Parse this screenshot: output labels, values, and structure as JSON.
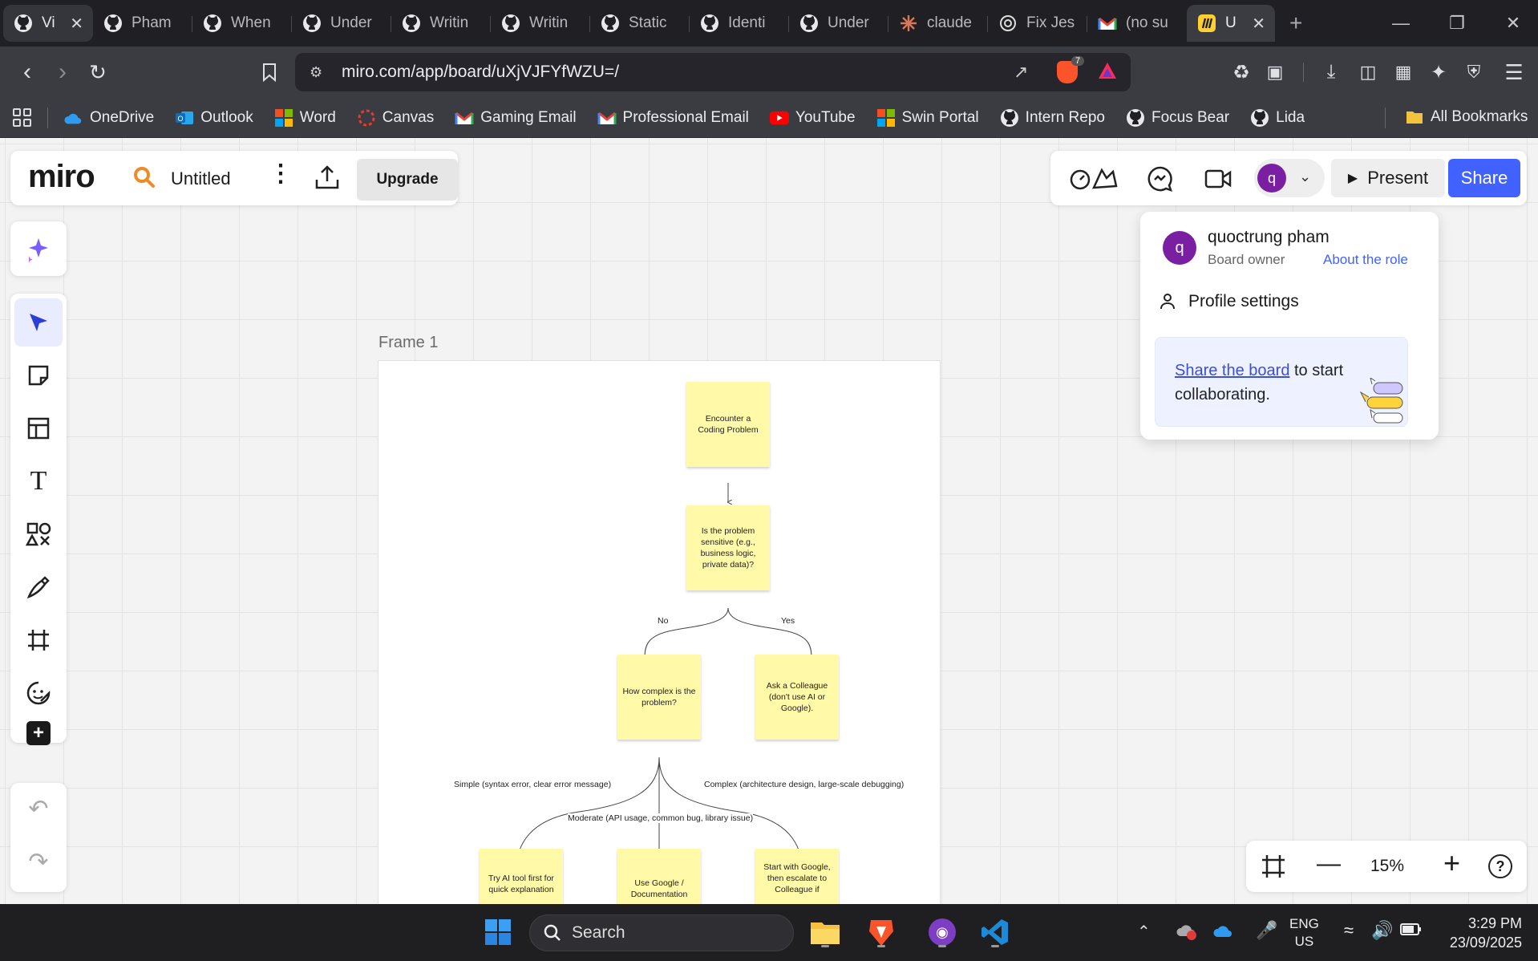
{
  "browser": {
    "tabs": [
      {
        "label": "Vi",
        "icon": "github-icon"
      },
      {
        "label": "Pham",
        "icon": "github-icon"
      },
      {
        "label": "When",
        "icon": "github-icon"
      },
      {
        "label": "Under",
        "icon": "github-icon"
      },
      {
        "label": "Writin",
        "icon": "github-icon"
      },
      {
        "label": "Writin",
        "icon": "github-icon"
      },
      {
        "label": "Static",
        "icon": "github-icon"
      },
      {
        "label": "Identi",
        "icon": "github-icon"
      },
      {
        "label": "Under",
        "icon": "github-icon"
      },
      {
        "label": "claude",
        "icon": "claude-icon"
      },
      {
        "label": "Fix Jes",
        "icon": "openai-icon"
      },
      {
        "label": "(no su",
        "icon": "gmail-icon"
      },
      {
        "label": "U",
        "icon": "miro-icon"
      }
    ],
    "url": "miro.com/app/board/uXjVJFYfWZU=/",
    "brave_badge": "7",
    "bookmarks": [
      {
        "label": "OneDrive",
        "icon": "onedrive-icon"
      },
      {
        "label": "Outlook",
        "icon": "outlook-icon"
      },
      {
        "label": "Word",
        "icon": "microsoft-icon"
      },
      {
        "label": "Canvas",
        "icon": "canvas-icon"
      },
      {
        "label": "Gaming Email",
        "icon": "gmail-icon"
      },
      {
        "label": "Professional Email",
        "icon": "gmail-icon"
      },
      {
        "label": "YouTube",
        "icon": "youtube-icon"
      },
      {
        "label": "Swin Portal",
        "icon": "microsoft-icon"
      },
      {
        "label": "Intern Repo",
        "icon": "github-icon"
      },
      {
        "label": "Focus Bear",
        "icon": "github-icon"
      },
      {
        "label": "Lida",
        "icon": "github-icon"
      }
    ],
    "all_bookmarks": "All Bookmarks"
  },
  "miro": {
    "logo": "miro",
    "board_title": "Untitled",
    "upgrade": "Upgrade",
    "present": "Present",
    "share": "Share",
    "avatar_letter": "q",
    "zoom": "15%",
    "frame_label": "Frame 1",
    "accent": "#4262ff",
    "sticky_color": "#fff9a8"
  },
  "profile_popover": {
    "name": "quoctrung pham",
    "role": "Board owner",
    "about_role": "About the role",
    "profile_settings": "Profile settings",
    "share_link": "Share the board",
    "share_rest": " to start collaborating."
  },
  "flowchart": {
    "nodes": {
      "start": "Encounter a Coding Problem",
      "sensitive": "Is the problem sensitive (e.g., business logic, private data)?",
      "complexity": "How complex is the problem?",
      "colleague": "Ask a Colleague (don't use AI or Google).",
      "ai_tool": "Try AI tool first for quick explanation",
      "google": "Use Google / Documentation",
      "escalate": "Start with Google, then escalate to Colleague if"
    },
    "edge_labels": {
      "no": "No",
      "yes": "Yes",
      "simple": "Simple (syntax error, clear error message)",
      "moderate": "Moderate (API usage, common bug, library issue)",
      "complex": "Complex (architecture design, large-scale debugging)"
    }
  },
  "taskbar": {
    "search": "Search",
    "lang_top": "ENG",
    "lang_bottom": "US",
    "time": "3:29 PM",
    "date": "23/09/2025"
  }
}
